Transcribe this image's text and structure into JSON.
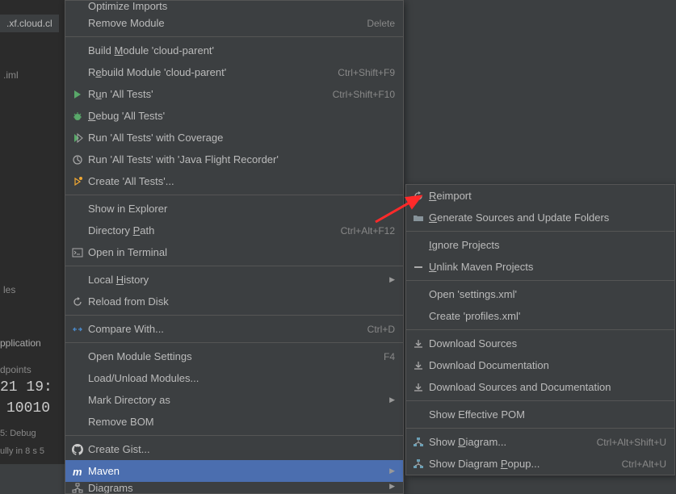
{
  "bg": {
    "tab": ".xf.cloud.cl",
    "iml": ".iml",
    "les": "les",
    "app": "pplication",
    "dpoints": "dpoints",
    "time": "21 19:",
    "code": "10010",
    "debug": "  5: Debug",
    "success": "ully in 8 s 5"
  },
  "main_menu": [
    {
      "type": "item",
      "label": "Optimize Imports",
      "shortcut": "",
      "clipped": true
    },
    {
      "type": "item",
      "label": "Remove Module",
      "shortcut": "Delete"
    },
    {
      "type": "sep"
    },
    {
      "type": "item",
      "label": "Build Module 'cloud-parent'",
      "u": 6
    },
    {
      "type": "item",
      "label": "Rebuild Module 'cloud-parent'",
      "u": 1,
      "shortcut": "Ctrl+Shift+F9"
    },
    {
      "type": "item",
      "icon": "run",
      "label": "Run 'All Tests'",
      "u": 1,
      "shortcut": "Ctrl+Shift+F10"
    },
    {
      "type": "item",
      "icon": "debug",
      "label": "Debug 'All Tests'",
      "u": 0
    },
    {
      "type": "item",
      "icon": "coverage",
      "label": "Run 'All Tests' with Coverage"
    },
    {
      "type": "item",
      "icon": "profiler",
      "label": "Run 'All Tests' with 'Java Flight Recorder'"
    },
    {
      "type": "item",
      "icon": "create",
      "label": "Create 'All Tests'..."
    },
    {
      "type": "sep"
    },
    {
      "type": "item",
      "label": "Show in Explorer"
    },
    {
      "type": "item",
      "label": "Directory Path",
      "u": 10,
      "shortcut": "Ctrl+Alt+F12"
    },
    {
      "type": "item",
      "icon": "terminal",
      "label": "Open in Terminal"
    },
    {
      "type": "sep"
    },
    {
      "type": "item",
      "label": "Local History",
      "u": 6,
      "submenu": true
    },
    {
      "type": "item",
      "icon": "reload",
      "label": "Reload from Disk"
    },
    {
      "type": "sep"
    },
    {
      "type": "item",
      "icon": "compare",
      "label": "Compare With...",
      "shortcut": "Ctrl+D"
    },
    {
      "type": "sep"
    },
    {
      "type": "item",
      "label": "Open Module Settings",
      "shortcut": "F4"
    },
    {
      "type": "item",
      "label": "Load/Unload Modules..."
    },
    {
      "type": "item",
      "label": "Mark Directory as",
      "submenu": true
    },
    {
      "type": "item",
      "label": "Remove BOM"
    },
    {
      "type": "sep"
    },
    {
      "type": "item",
      "icon": "github",
      "label": "Create Gist..."
    },
    {
      "type": "item",
      "icon": "maven",
      "label": "Maven",
      "highlighted": true,
      "submenu": true
    },
    {
      "type": "item",
      "icon": "diagrams",
      "label": "Diagrams",
      "submenu": true,
      "clipped_bottom": true
    }
  ],
  "sub_menu": [
    {
      "type": "item",
      "icon": "reload",
      "label": "Reimport",
      "u": 0
    },
    {
      "type": "item",
      "icon": "folder",
      "label": "Generate Sources and Update Folders",
      "u": 0
    },
    {
      "type": "sep"
    },
    {
      "type": "item",
      "label": "Ignore Projects",
      "u": 0
    },
    {
      "type": "item",
      "icon": "minus",
      "label": "Unlink Maven Projects",
      "u": 0
    },
    {
      "type": "sep"
    },
    {
      "type": "item",
      "label": "Open 'settings.xml'"
    },
    {
      "type": "item",
      "label": "Create 'profiles.xml'"
    },
    {
      "type": "sep"
    },
    {
      "type": "item",
      "icon": "download",
      "label": "Download Sources"
    },
    {
      "type": "item",
      "icon": "download",
      "label": "Download Documentation"
    },
    {
      "type": "item",
      "icon": "download",
      "label": "Download Sources and Documentation"
    },
    {
      "type": "sep"
    },
    {
      "type": "item",
      "label": "Show Effective POM"
    },
    {
      "type": "sep"
    },
    {
      "type": "item",
      "icon": "diagram",
      "label": "Show Diagram...",
      "u": 5,
      "shortcut": "Ctrl+Alt+Shift+U"
    },
    {
      "type": "item",
      "icon": "diagram",
      "label": "Show Diagram Popup...",
      "u": 13,
      "shortcut": "Ctrl+Alt+U"
    }
  ]
}
